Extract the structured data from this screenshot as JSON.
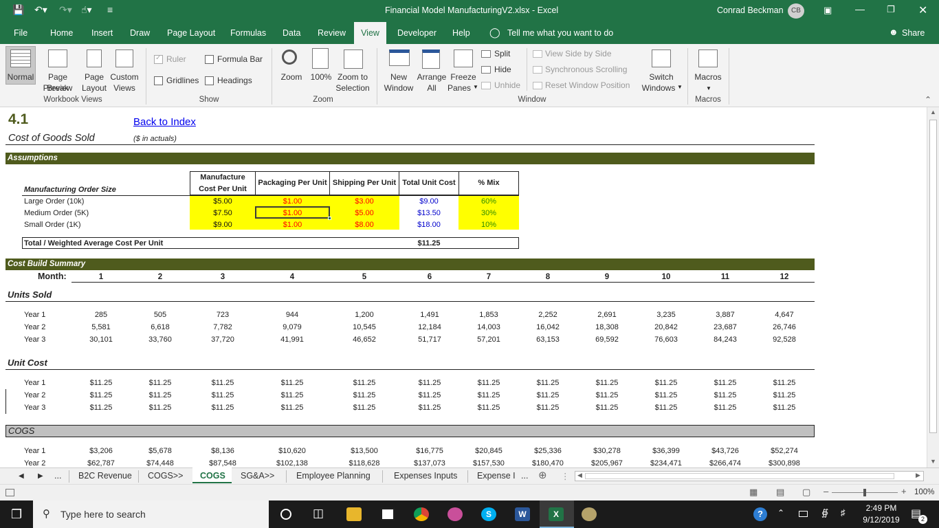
{
  "window": {
    "title": "Financial Model ManufacturingV2.xlsx  -  Excel",
    "user": "Conrad Beckman",
    "user_initials": "CB"
  },
  "tabs": [
    "File",
    "Home",
    "Insert",
    "Draw",
    "Page Layout",
    "Formulas",
    "Data",
    "Review",
    "View",
    "Developer",
    "Help"
  ],
  "tell_me": "Tell me what you want to do",
  "share": "Share",
  "ribbon": {
    "workbook_views": {
      "normal": "Normal",
      "page_break_1": "Page Break",
      "page_break_2": "Preview",
      "page_layout_1": "Page",
      "page_layout_2": "Layout",
      "custom_1": "Custom",
      "custom_2": "Views",
      "group": "Workbook Views"
    },
    "show": {
      "ruler": "Ruler",
      "formula_bar": "Formula Bar",
      "gridlines": "Gridlines",
      "headings": "Headings",
      "group": "Show"
    },
    "zoom": {
      "zoom": "Zoom",
      "hundred": "100%",
      "zoom_sel_1": "Zoom to",
      "zoom_sel_2": "Selection",
      "group": "Zoom"
    },
    "window": {
      "new_1": "New",
      "new_2": "Window",
      "arrange_1": "Arrange",
      "arrange_2": "All",
      "freeze_1": "Freeze",
      "freeze_2": "Panes",
      "split": "Split",
      "hide": "Hide",
      "unhide": "Unhide",
      "side": "View Side by Side",
      "sync": "Synchronous Scrolling",
      "reset": "Reset Window Position",
      "switch_1": "Switch",
      "switch_2": "Windows",
      "group": "Window"
    },
    "macros": {
      "macros": "Macros",
      "group": "Macros"
    }
  },
  "sheet": {
    "section_no": "4.1",
    "section_title": "Cost of Goods Sold",
    "back_link": "Back to Index",
    "units_note": "($ in actuals)",
    "assumptions_band": "Assumptions",
    "assump_headers": {
      "manufacture_1": "Manufacture",
      "manufacture_2": "Cost Per Unit",
      "packaging": "Packaging Per Unit",
      "shipping": "Shipping Per Unit",
      "total": "Total Unit Cost",
      "mix": "% Mix"
    },
    "order_size_label": "Manufacturing Order Size",
    "orders": [
      {
        "name": "Large Order (10k)",
        "manufacture": "$5.00",
        "packaging": "$1.00",
        "shipping": "$3.00",
        "total": "$9.00",
        "mix": "60%"
      },
      {
        "name": "Medium Order (5K)",
        "manufacture": "$7.50",
        "packaging": "$1.00",
        "shipping": "$5.00",
        "total": "$13.50",
        "mix": "30%"
      },
      {
        "name": "Small Order (1K)",
        "manufacture": "$9.00",
        "packaging": "$1.00",
        "shipping": "$8.00",
        "total": "$18.00",
        "mix": "10%"
      }
    ],
    "weighted_label": "Total / Weighted Average Cost Per Unit",
    "weighted_value": "$11.25",
    "summary_band": "Cost Build Summary",
    "month_label": "Month:",
    "months": [
      "1",
      "2",
      "3",
      "4",
      "5",
      "6",
      "7",
      "8",
      "9",
      "10",
      "11",
      "12"
    ],
    "units_sold": {
      "title": "Units Sold",
      "rows": [
        {
          "label": "Year 1",
          "values": [
            "285",
            "505",
            "723",
            "944",
            "1,200",
            "1,491",
            "1,853",
            "2,252",
            "2,691",
            "3,235",
            "3,887",
            "4,647"
          ]
        },
        {
          "label": "Year 2",
          "values": [
            "5,581",
            "6,618",
            "7,782",
            "9,079",
            "10,545",
            "12,184",
            "14,003",
            "16,042",
            "18,308",
            "20,842",
            "23,687",
            "26,746"
          ]
        },
        {
          "label": "Year 3",
          "values": [
            "30,101",
            "33,760",
            "37,720",
            "41,991",
            "46,652",
            "51,717",
            "57,201",
            "63,153",
            "69,592",
            "76,603",
            "84,243",
            "92,528"
          ]
        }
      ]
    },
    "unit_cost": {
      "title": "Unit Cost",
      "rows": [
        {
          "label": "Year 1",
          "values": [
            "$11.25",
            "$11.25",
            "$11.25",
            "$11.25",
            "$11.25",
            "$11.25",
            "$11.25",
            "$11.25",
            "$11.25",
            "$11.25",
            "$11.25",
            "$11.25"
          ]
        },
        {
          "label": "Year 2",
          "values": [
            "$11.25",
            "$11.25",
            "$11.25",
            "$11.25",
            "$11.25",
            "$11.25",
            "$11.25",
            "$11.25",
            "$11.25",
            "$11.25",
            "$11.25",
            "$11.25"
          ]
        },
        {
          "label": "Year 3",
          "values": [
            "$11.25",
            "$11.25",
            "$11.25",
            "$11.25",
            "$11.25",
            "$11.25",
            "$11.25",
            "$11.25",
            "$11.25",
            "$11.25",
            "$11.25",
            "$11.25"
          ]
        }
      ]
    },
    "cogs": {
      "title": "COGS",
      "rows": [
        {
          "label": "Year 1",
          "values": [
            "$3,206",
            "$5,678",
            "$8,136",
            "$10,620",
            "$13,500",
            "$16,775",
            "$20,845",
            "$25,336",
            "$30,278",
            "$36,399",
            "$43,726",
            "$52,274"
          ]
        },
        {
          "label": "Year 2",
          "values": [
            "$62,787",
            "$74,448",
            "$87,548",
            "$102,138",
            "$118,628",
            "$137,073",
            "$157,530",
            "$180,470",
            "$205,967",
            "$234,471",
            "$266,474",
            "$300,898"
          ]
        }
      ]
    }
  },
  "sheet_tabs": {
    "ellipsis": "...",
    "tabs": [
      "B2C Revenue",
      "COGS>>",
      "COGS",
      "SG&A>>",
      "Employee Planning",
      "Expenses Inputs",
      "Expense I"
    ],
    "more": "..."
  },
  "status": {
    "zoom": "100%"
  },
  "taskbar": {
    "search": "Type here to search",
    "time": "2:49 PM",
    "date": "9/12/2019",
    "notif": "2"
  },
  "colors": {
    "excel_green": "#217346",
    "band_olive": "#4f5b1d",
    "highlight_yellow": "#ffff00",
    "input_red": "#ff0000",
    "calc_blue": "#0000cc",
    "mix_green": "#2e8b00"
  }
}
